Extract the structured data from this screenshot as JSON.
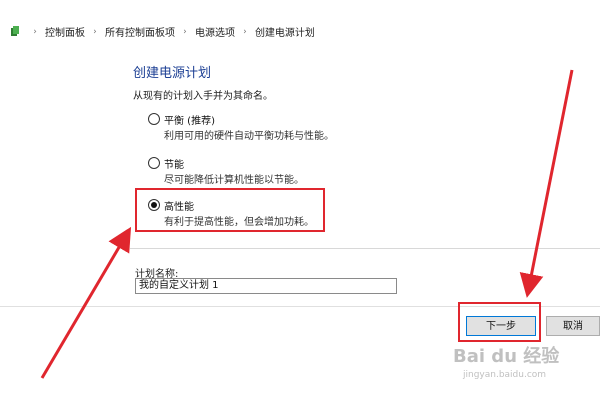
{
  "breadcrumb": {
    "items": [
      "控制面板",
      "所有控制面板项",
      "电源选项",
      "创建电源计划"
    ]
  },
  "header": {
    "title": "创建电源计划",
    "subtitle": "从现有的计划入手并为其命名。"
  },
  "plans": [
    {
      "label": "平衡 (推荐)",
      "description": "利用可用的硬件自动平衡功耗与性能。",
      "selected": false
    },
    {
      "label": "节能",
      "description": "尽可能降低计算机性能以节能。",
      "selected": false
    },
    {
      "label": "高性能",
      "description": "有利于提高性能，但会增加功耗。",
      "selected": true
    }
  ],
  "plan_name": {
    "label": "计划名称:",
    "value": "我的自定义计划 1"
  },
  "buttons": {
    "next": "下一步",
    "cancel": "取消"
  },
  "watermark": {
    "brand": "Bai du 经验",
    "url": "jingyan.baidu.com"
  },
  "colors": {
    "title": "#1c3f94",
    "highlight": "#e0262e",
    "primary_border": "#0078d7"
  }
}
